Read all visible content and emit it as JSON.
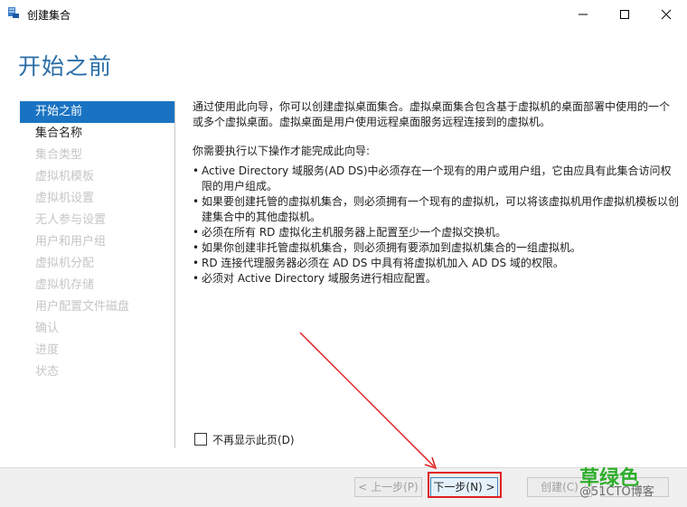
{
  "window": {
    "title": "创建集合",
    "icon": "server-manager-icon"
  },
  "page": {
    "title": "开始之前"
  },
  "nav": {
    "items": [
      {
        "label": "开始之前",
        "state": "selected"
      },
      {
        "label": "集合名称",
        "state": "enabled"
      },
      {
        "label": "集合类型",
        "state": "disabled"
      },
      {
        "label": "虚拟机模板",
        "state": "disabled"
      },
      {
        "label": "虚拟机设置",
        "state": "disabled"
      },
      {
        "label": "无人参与设置",
        "state": "disabled"
      },
      {
        "label": "用户和用户组",
        "state": "disabled"
      },
      {
        "label": "虚拟机分配",
        "state": "disabled"
      },
      {
        "label": "虚拟机存储",
        "state": "disabled"
      },
      {
        "label": "用户配置文件磁盘",
        "state": "disabled"
      },
      {
        "label": "确认",
        "state": "disabled"
      },
      {
        "label": "进度",
        "state": "disabled"
      },
      {
        "label": "状态",
        "state": "disabled"
      }
    ]
  },
  "content": {
    "intro": "通过使用此向导，你可以创建虚拟桌面集合。虚拟桌面集合包含基于虚拟机的桌面部署中使用的一个或多个虚拟桌面。虚拟桌面是用户使用远程桌面服务远程连接到的虚拟机。",
    "requirements_heading": "你需要执行以下操作才能完成此向导:",
    "bullets": [
      "Active Directory 域服务(AD DS)中必须存在一个现有的用户或用户组，它由应具有此集合访问权限的用户组成。",
      "如果要创建托管的虚拟机集合，则必须拥有一个现有的虚拟机，可以将该虚拟机用作虚拟机模板以创建集合中的其他虚拟机。",
      "必须在所有 RD 虚拟化主机服务器上配置至少一个虚拟交换机。",
      "如果你创建非托管虚拟机集合，则必须拥有要添加到虚拟机集合的一组虚拟机。",
      "RD 连接代理服务器必须在 AD DS 中具有将虚拟机加入 AD DS 域的权限。",
      "必须对 Active Directory 域服务进行相应配置。"
    ]
  },
  "checkbox": {
    "label": "不再显示此页(D)",
    "checked": false
  },
  "buttons": {
    "prev": "< 上一步(P)",
    "next": "下一步(N) >",
    "create": "创建(C)"
  },
  "watermark": {
    "line1": "草绿色",
    "line2": "@51CTO博客"
  },
  "colors": {
    "accent": "#1a73c2",
    "title": "#2b6ea8",
    "annotation": "#e0201f",
    "watermark": "#2fae2c"
  }
}
